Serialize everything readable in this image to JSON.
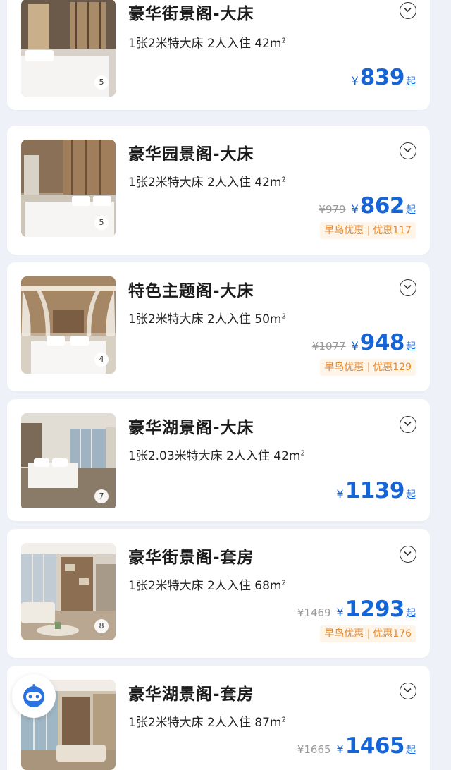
{
  "rooms": [
    {
      "title": "豪华街景阁-大床",
      "spec": "1张2米特大床  2人入住  42m",
      "spec_sup": "2",
      "original_price": "",
      "currency": "¥",
      "price": "839",
      "price_suffix": "起",
      "promo_label": "",
      "promo_discount": "",
      "photo_count": "5",
      "image_icon": "bedroom-photo"
    },
    {
      "title": "豪华园景阁-大床",
      "spec": "1张2米特大床  2人入住  42m",
      "spec_sup": "2",
      "original_price": "¥979",
      "currency": "¥",
      "price": "862",
      "price_suffix": "起",
      "promo_label": "早鸟优惠",
      "promo_discount": "优惠117",
      "photo_count": "5",
      "image_icon": "bedroom-photo"
    },
    {
      "title": "特色主题阁-大床",
      "spec": "1张2米特大床  2人入住  50m",
      "spec_sup": "2",
      "original_price": "¥1077",
      "currency": "¥",
      "price": "948",
      "price_suffix": "起",
      "promo_label": "早鸟优惠",
      "promo_discount": "优惠129",
      "photo_count": "4",
      "image_icon": "canopy-bed-photo"
    },
    {
      "title": "豪华湖景阁-大床",
      "spec": "1张2.03米特大床  2人入住  42m",
      "spec_sup": "2",
      "original_price": "",
      "currency": "¥",
      "price": "1139",
      "price_suffix": "起",
      "promo_label": "",
      "promo_discount": "",
      "photo_count": "7",
      "image_icon": "bedroom-photo"
    },
    {
      "title": "豪华街景阁-套房",
      "spec": "1张2米特大床  2人入住  68m",
      "spec_sup": "2",
      "original_price": "¥1469",
      "currency": "¥",
      "price": "1293",
      "price_suffix": "起",
      "promo_label": "早鸟优惠",
      "promo_discount": "优惠176",
      "photo_count": "8",
      "image_icon": "living-room-photo"
    },
    {
      "title": "豪华湖景阁-套房",
      "spec": "1张2米特大床  2人入住  87m",
      "spec_sup": "2",
      "original_price": "¥1665",
      "currency": "¥",
      "price": "1465",
      "price_suffix": "起",
      "promo_label": "",
      "promo_discount": "",
      "photo_count": "",
      "image_icon": "living-room-photo"
    }
  ],
  "floating_assistant": {
    "icon": "robot-assistant-icon"
  },
  "colors": {
    "background": "#eef2f8",
    "price_blue": "#1565d8",
    "promo_orange": "#e8892b",
    "promo_bg": "#fff4e8"
  }
}
